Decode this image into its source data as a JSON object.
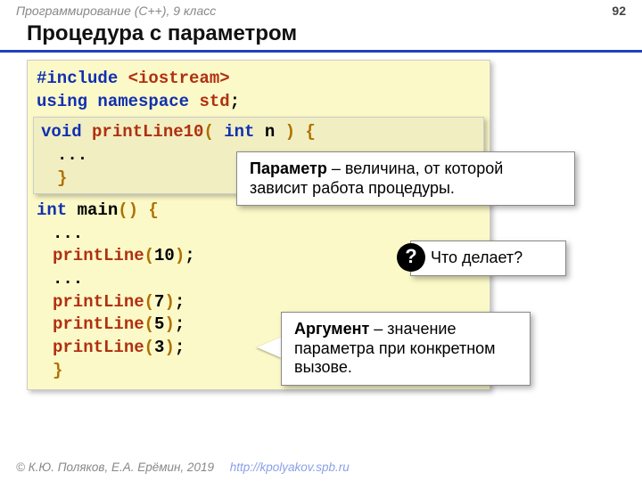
{
  "header": {
    "course": "Программирование (C++), 9 класс",
    "page": "92"
  },
  "title": "Процедура с параметром",
  "code": {
    "l1a": "#include ",
    "l1b": "<",
    "l1c": "iostream",
    "l1d": ">",
    "l2a": "using ",
    "l2b": "namespace ",
    "l2c": "std",
    "l2d": ";",
    "fn1a": "void ",
    "fn1b": "printLine10",
    "fn1c": "( ",
    "fn1d": "int ",
    "fn1e": "n",
    "fn1f": " ) {",
    "fn2": "...",
    "fn3": "}",
    "m1a": "int ",
    "m1b": "main",
    "m1c": "() {",
    "m2": "...",
    "m3a": "printLine",
    "m3b": "(",
    "m3c": "10",
    "m3d": ")",
    "m3e": ";",
    "m4": "...",
    "m5a": "printLine",
    "m5b": "(",
    "m5c": "7",
    "m5d": ")",
    "m5e": ";",
    "m6a": "printLine",
    "m6b": "(",
    "m6c": "5",
    "m6d": ")",
    "m6e": ";",
    "m7a": "printLine",
    "m7b": "(",
    "m7c": "3",
    "m7d": ")",
    "m7e": ";",
    "m8": "}"
  },
  "callouts": {
    "param_b": "Параметр",
    "param_t": " – величина, от которой зависит работа процедуры.",
    "q_text": "Что делает?",
    "arg_b": "Аргумент",
    "arg_t": " – значение параметра при конкретном вызове."
  },
  "footer": {
    "copyright": "© К.Ю. Поляков, Е.А. Ерёмин, 2019",
    "link": "http://kpolyakov.spb.ru"
  },
  "qmark": "?"
}
